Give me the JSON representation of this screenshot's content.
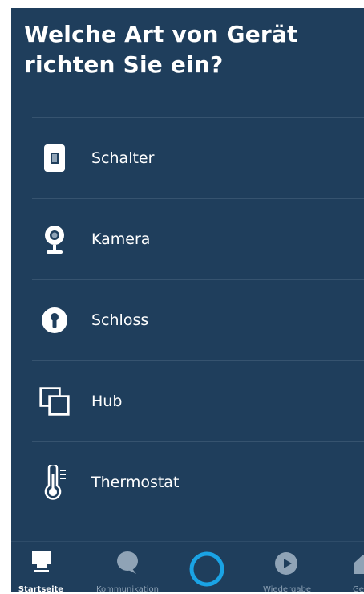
{
  "page": {
    "title": "Welche Art von Gerät richten Sie ein?"
  },
  "device_types": [
    {
      "label": "Schalter",
      "icon": "switch-icon"
    },
    {
      "label": "Kamera",
      "icon": "camera-icon"
    },
    {
      "label": "Schloss",
      "icon": "lock-icon"
    },
    {
      "label": "Hub",
      "icon": "hub-icon"
    },
    {
      "label": "Thermostat",
      "icon": "thermostat-icon"
    }
  ],
  "nav": {
    "home": {
      "label": "Startseite",
      "icon": "home-icon",
      "active": true
    },
    "communication": {
      "label": "Kommunikation",
      "icon": "chat-bubble-icon"
    },
    "alexa": {
      "icon": "alexa-ring-icon"
    },
    "play": {
      "label": "Wiedergabe",
      "icon": "play-icon"
    },
    "devices": {
      "label": "Ge",
      "icon": "devices-icon"
    }
  },
  "colors": {
    "background": "#1f3e5c",
    "divider": "#36536f",
    "text": "#ffffff",
    "nav_inactive": "#8fa3b6",
    "alexa_accent": "#1aa3e5"
  }
}
